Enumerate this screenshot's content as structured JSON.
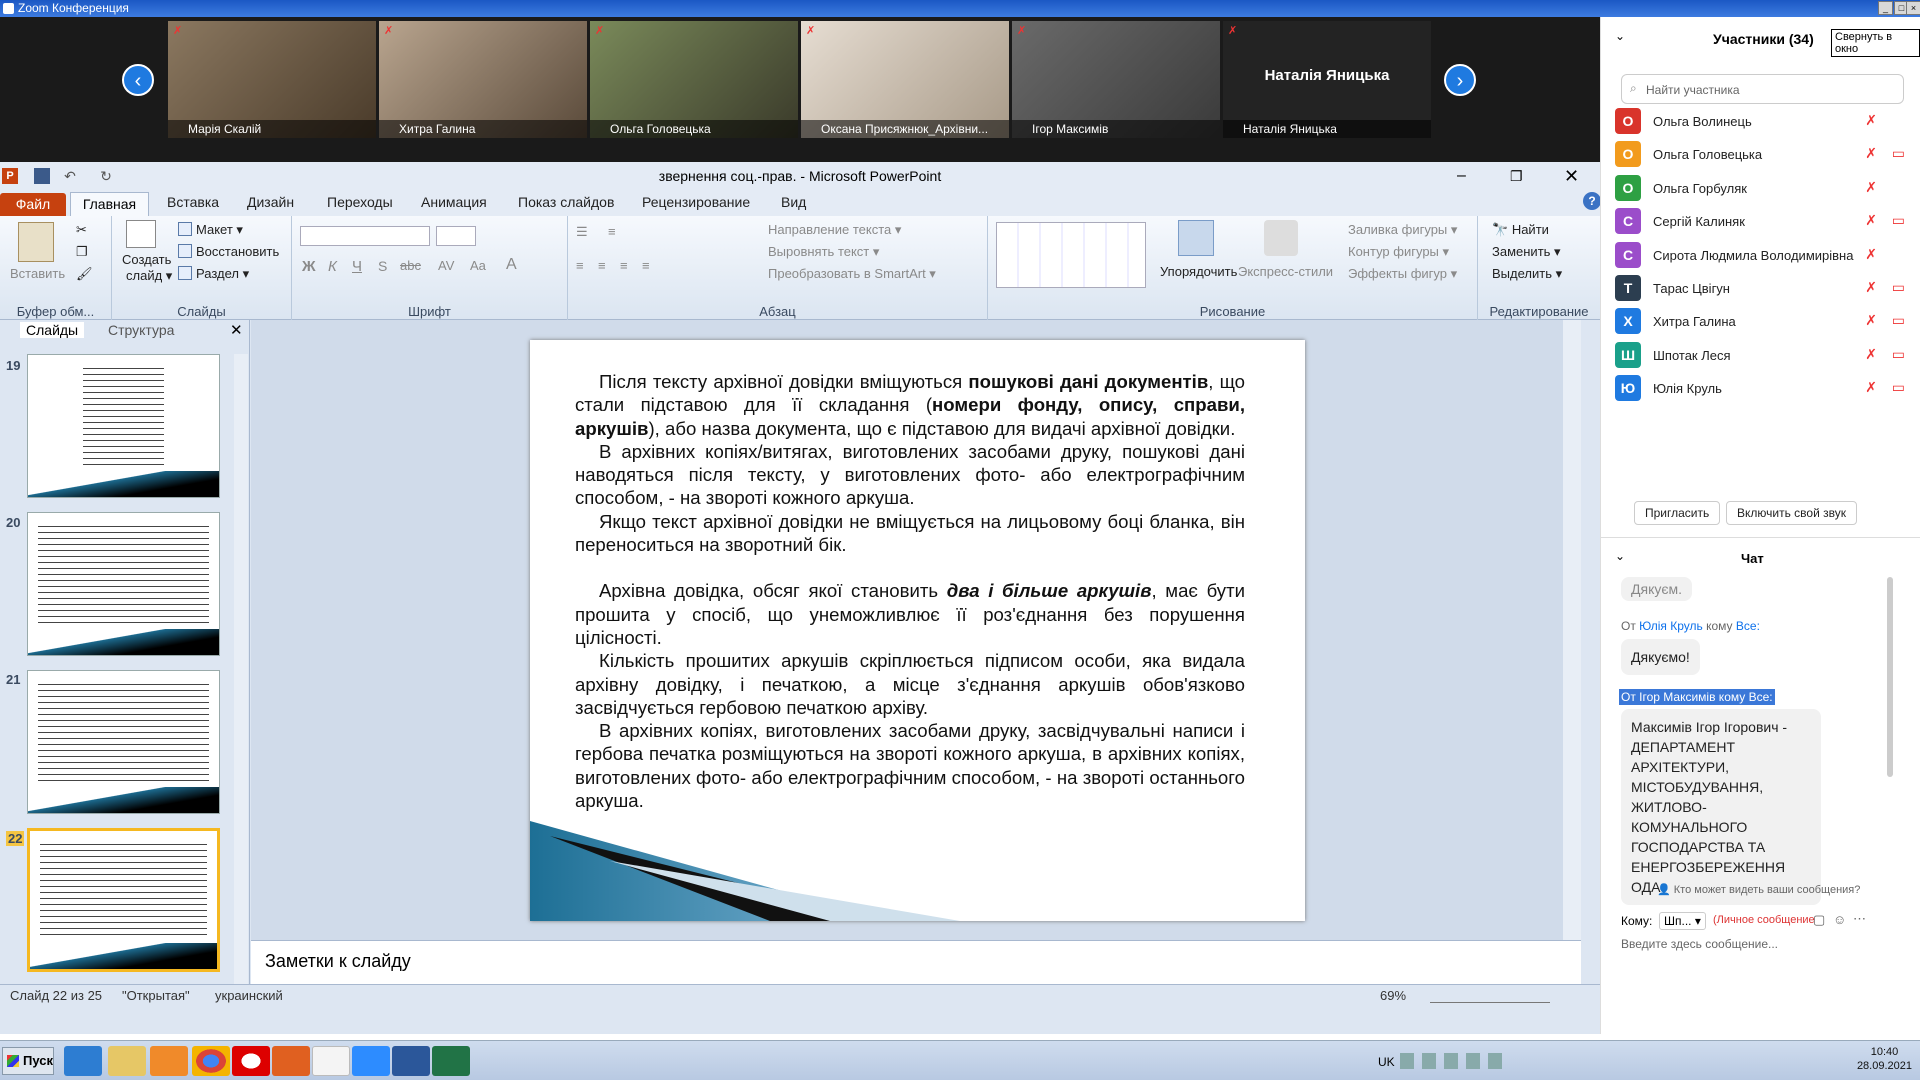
{
  "window": {
    "title": "Zoom Конференция"
  },
  "video": {
    "tiles": [
      {
        "name": "Марія Скалій",
        "bg": "#6a5a44"
      },
      {
        "name": "Хитра Галина",
        "bg": "#8a7a6a"
      },
      {
        "name": "Ольга Головецька",
        "bg": "#5e6a4a"
      },
      {
        "name": "Оксана Присяжнюк_Архівни...",
        "bg": "#c9c0b4"
      },
      {
        "name": "Ігор Максимів",
        "bg": "#585858"
      },
      {
        "name": "Наталія Яницька",
        "bg": "#1c1c1c",
        "center_label": "Наталія Яницька"
      }
    ]
  },
  "ppt": {
    "title": "звернення соц.-прав.  -  Microsoft PowerPoint",
    "tabs": {
      "file": "Файл",
      "home": "Главная",
      "insert": "Вставка",
      "design": "Дизайн",
      "transitions": "Переходы",
      "animation": "Анимация",
      "slideshow": "Показ слайдов",
      "review": "Рецензирование",
      "view": "Вид"
    },
    "ribbon": {
      "paste": "Вставить",
      "clipboard": "Буфер обм...",
      "new_slide_1": "Создать",
      "new_slide_2": "слайд ▾",
      "layout": "Макет ▾",
      "reset": "Восстановить",
      "section": "Раздел ▾",
      "slides": "Слайды",
      "font": "Шрифт",
      "paragraph": "Абзац",
      "text_direction": "Направление текста ▾",
      "align_text": "Выровнять текст ▾",
      "smartart": "Преобразовать в SmartArt ▾",
      "arrange": "Упорядочить",
      "quick_styles": "Экспресс-стили",
      "fill": "Заливка фигуры ▾",
      "outline": "Контур фигуры ▾",
      "effects": "Эффекты фигур ▾",
      "drawing": "Рисование",
      "find": "Найти",
      "replace": "Заменить ▾",
      "select": "Выделить ▾",
      "editing": "Редактирование"
    },
    "panel_tabs": {
      "slides": "Слайды",
      "outline": "Структура"
    },
    "thumbnails": [
      {
        "num": "19"
      },
      {
        "num": "20"
      },
      {
        "num": "21"
      },
      {
        "num": "22"
      }
    ],
    "notes_placeholder": "Заметки к слайду",
    "status": {
      "slide": "Слайд 22 из 25",
      "theme": "\"Открытая\"",
      "lang": "украинский",
      "zoom": "69%"
    },
    "slide": {
      "p1_a": "Після тексту архівної довідки вміщуються ",
      "p1_b": "пошукові дані документів",
      "p1_c": ", що стали підставою для її складання (",
      "p1_d": "номери фонду, опису, справи, аркушів",
      "p1_e": "), або назва документа, що є підставою для видачі архівної довідки.",
      "p2": "В архівних копіях/витягах, виготовлених засобами друку, пошукові дані наводяться після тексту, у виготовлених фото- або електрографічним способом, - на звороті кожного аркуша.",
      "p3": "Якщо текст архівної довідки не вміщується на лицьовому боці бланка, він переноситься на зворотний бік.",
      "p4_a": "Архівна довідка, обсяг якої становить ",
      "p4_b": "два і більше аркушів",
      "p4_c": ", має бути прошита у спосіб, що унеможливлює її роз'єднання без порушення цілісності.",
      "p5": "Кількість прошитих аркушів скріплюється підписом особи, яка видала архівну довідку, і печаткою, а місце з'єднання аркушів обов'язково засвідчується гербовою печаткою архіву.",
      "p6": "В архівних копіях, виготовлених засобами друку, засвідчувальні написи і гербова печатка розміщуються на звороті кожного аркуша, в архівних копіях, виготовлених фото- або електрографічним способом, - на звороті останнього аркуша."
    }
  },
  "participants": {
    "header": "Участники (34)",
    "popout": "Свернуть в окно",
    "search_placeholder": "Найти участника",
    "list": [
      {
        "initial": "О",
        "name": "Ольга Волинець",
        "color": "#d9342b",
        "cam": false
      },
      {
        "initial": "О",
        "name": "Ольга Головецька",
        "color": "#f29b1d",
        "cam": true
      },
      {
        "initial": "О",
        "name": "Ольга Горбуляк",
        "color": "#2ea043",
        "cam": false
      },
      {
        "initial": "С",
        "name": "Сергій Калиняк",
        "color": "#9b4dca",
        "cam": true
      },
      {
        "initial": "С",
        "name": "Сирота Людмила Володимирівна",
        "color": "#9b4dca",
        "cam": false
      },
      {
        "initial": "Т",
        "name": "Тарас Цвігун",
        "color": "#2c3e50",
        "cam": true
      },
      {
        "initial": "Х",
        "name": "Хитра Галина",
        "color": "#1f7ae0",
        "cam": true
      },
      {
        "initial": "Ш",
        "name": "Шпотак Леся",
        "color": "#1aa08a",
        "cam": true
      },
      {
        "initial": "Ю",
        "name": "Юлія Круль",
        "color": "#1f7ae0",
        "cam": true
      }
    ],
    "invite": "Пригласить",
    "unmute": "Включить свой звук"
  },
  "chat": {
    "header": "Чат",
    "msg0": "Дякуєм.",
    "m1_from": "От ",
    "m1_sender": "Юлія Круль",
    "m1_to": " кому ",
    "m1_all": "Все:",
    "m1_text": "Дякуємо!",
    "m2_from": "От Ігор Максимів кому Все:",
    "m2_text": "Максимів Ігор Ігорович - ДЕПАРТАМЕНТ АРХІТЕКТУРИ, МІСТОБУДУВАННЯ, ЖИТЛОВО-КОМУНАЛЬНОГО ГОСПОДАРСТВА ТА ЕНЕРГОЗБЕРЕЖЕННЯ ОДА",
    "who_can_see": "Кто может видеть ваши сообщения?",
    "to_label": "Кому:",
    "to_value": "Шп... ▾",
    "private": "(Личное сообщение",
    "input_placeholder": "Введите здесь сообщение..."
  },
  "taskbar": {
    "start": "Пуск",
    "lang": "UK",
    "time": "10:40",
    "date": "28.09.2021"
  }
}
